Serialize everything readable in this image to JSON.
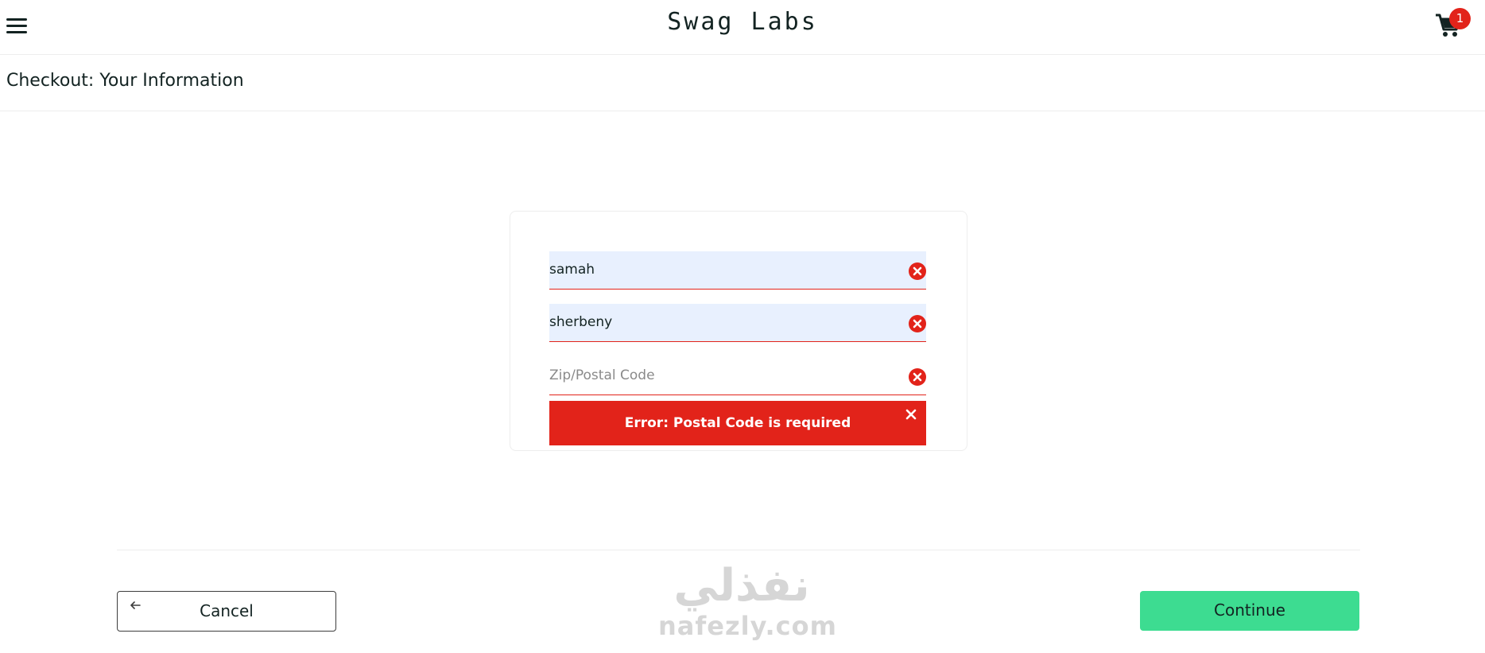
{
  "header": {
    "title": "Swag Labs",
    "cart_count": "1"
  },
  "subheader": {
    "title": "Checkout: Your Information"
  },
  "form": {
    "first_name_value": "samah",
    "last_name_value": "sherbeny",
    "postal_code_value": "",
    "postal_code_placeholder": "Zip/Postal Code",
    "error_message": "Error: Postal Code is required"
  },
  "footer": {
    "cancel_label": "Cancel",
    "continue_label": "Continue"
  },
  "watermark": {
    "arabic": "نفذلي",
    "latin": "nafezly.com"
  },
  "colors": {
    "accent_green": "#3ddc91",
    "error_red": "#e2231a",
    "autofill_blue": "#e8f0fe"
  }
}
